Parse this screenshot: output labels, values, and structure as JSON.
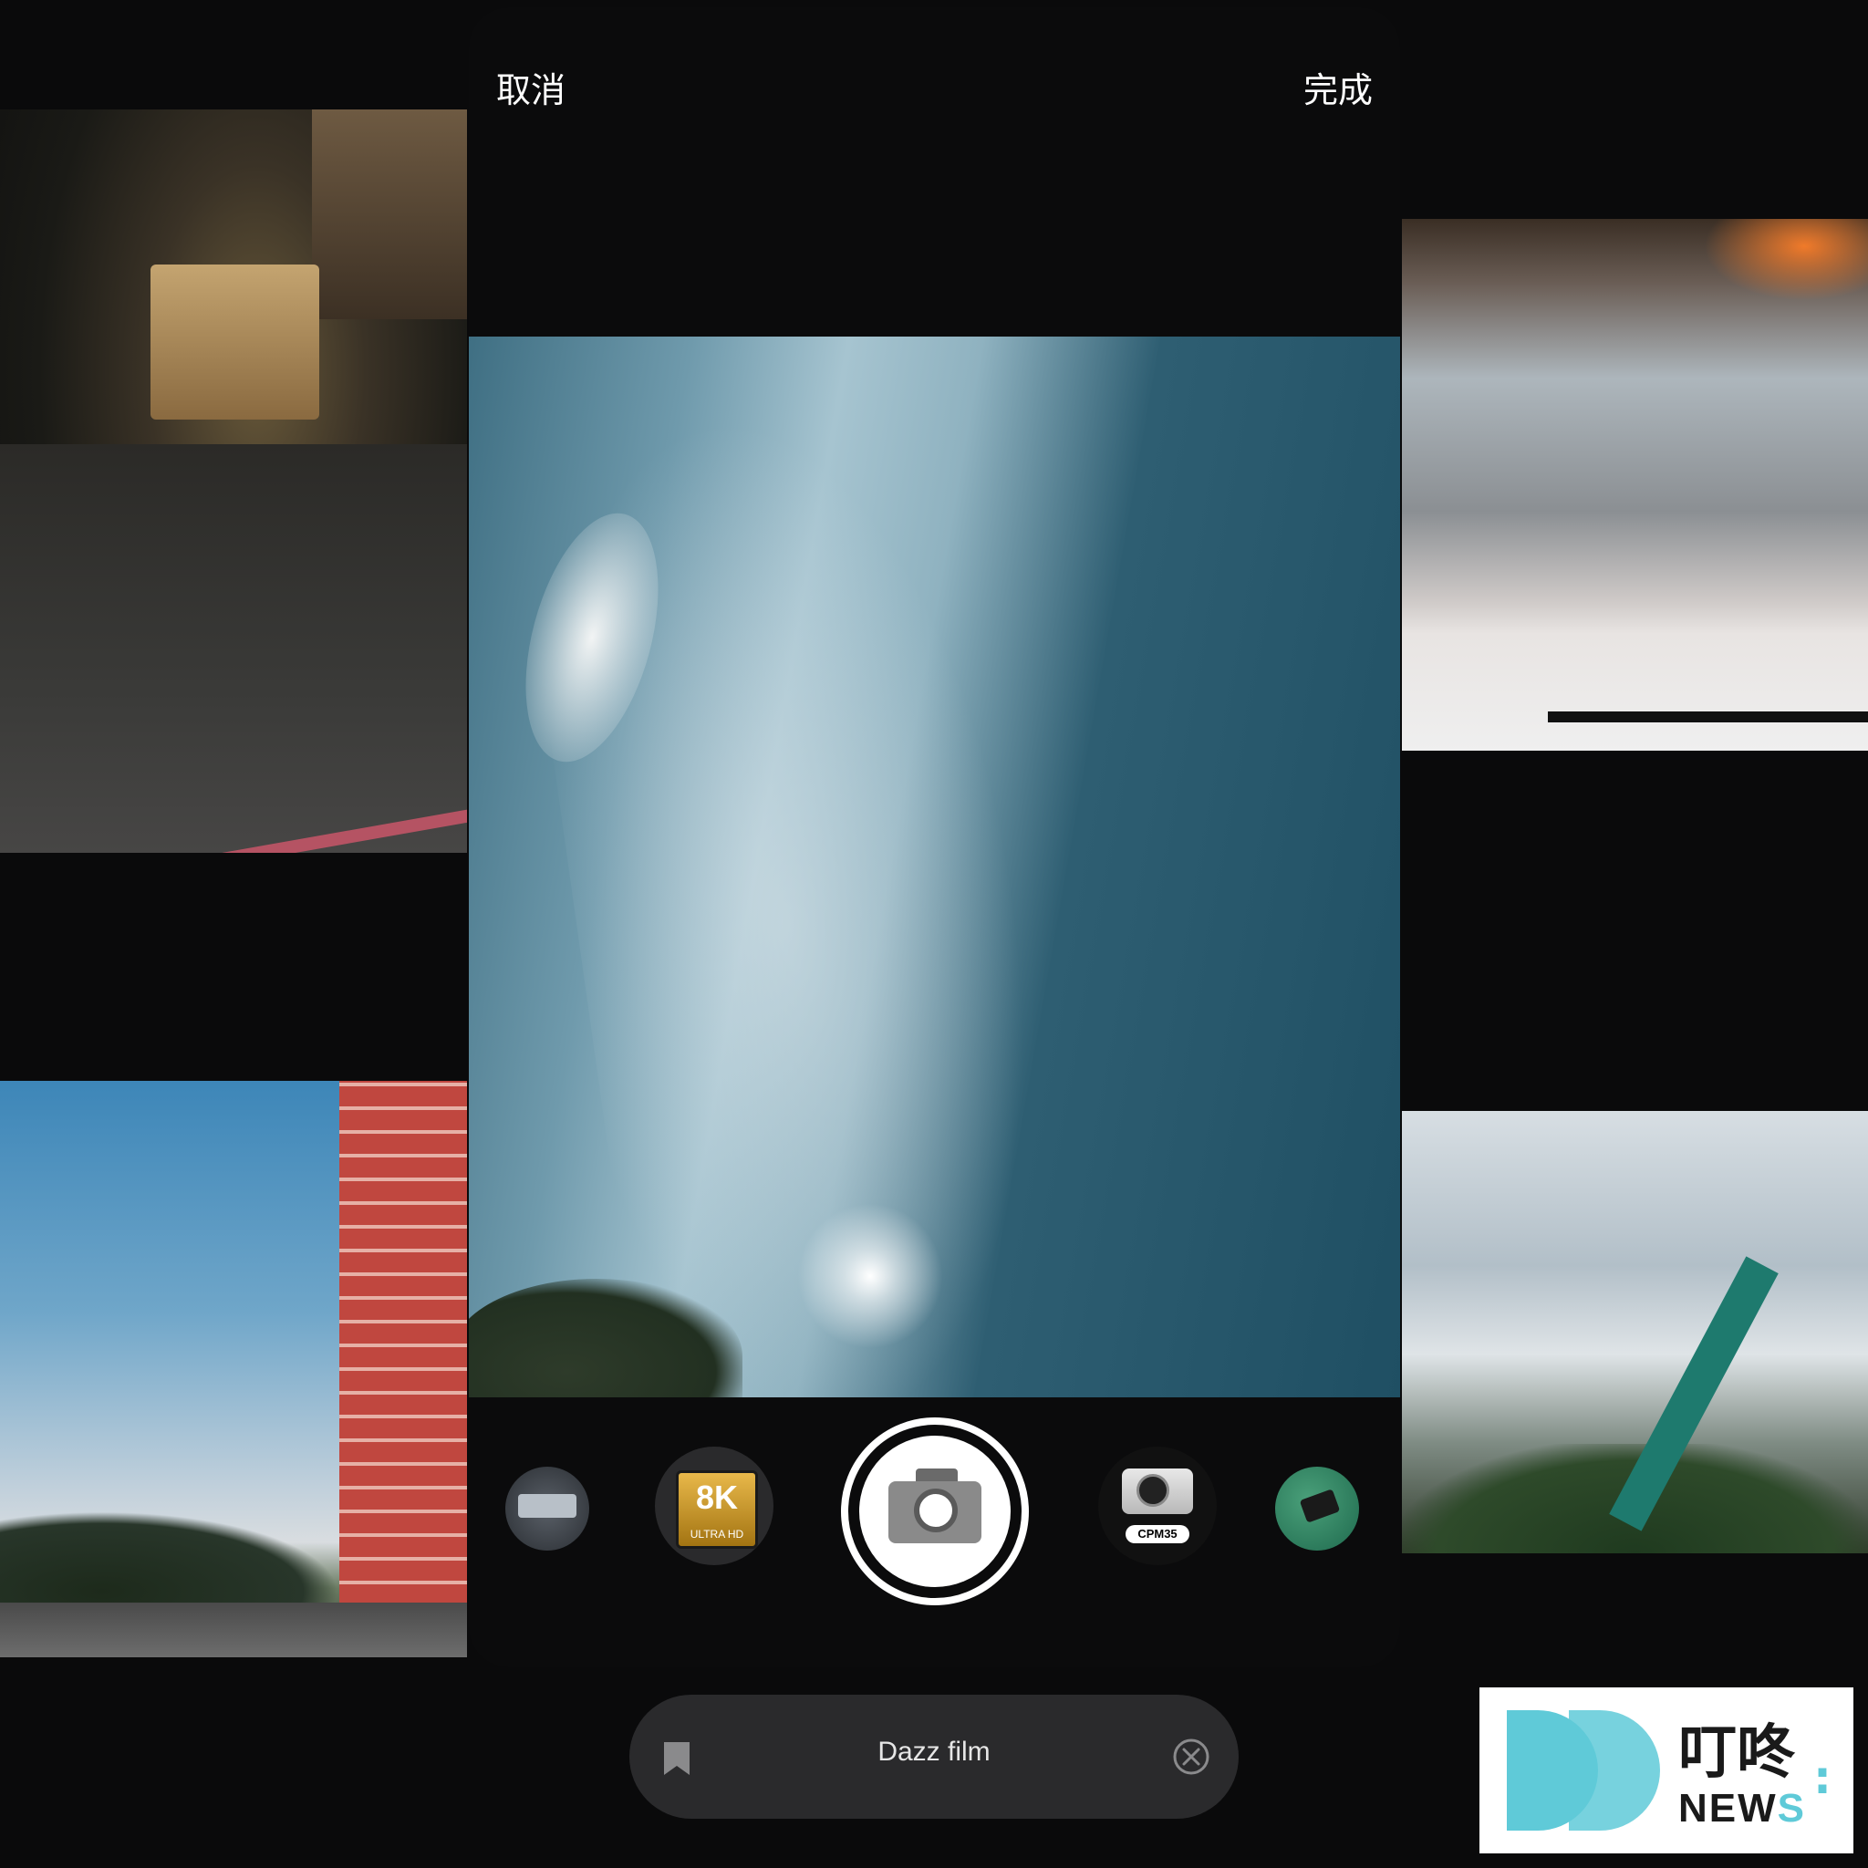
{
  "topbar": {
    "cancel_label": "取消",
    "done_label": "完成"
  },
  "viewfinder": {
    "description_icon": "film-preview"
  },
  "cameras": [
    {
      "icon": "retro-window-camera-icon"
    },
    {
      "icon": "ultra-hd-8k-camera-icon",
      "badge_main": "8K",
      "badge_sub": "ULTRA HD"
    },
    {
      "icon": "film-slr-camera-icon",
      "selected": true
    },
    {
      "icon": "cpm35-camera-icon",
      "label": "CPM35"
    },
    {
      "icon": "handheld-device-camera-icon"
    }
  ],
  "filterbar": {
    "name": "Dazz film",
    "bookmark_icon": "bookmark-icon",
    "clear_icon": "close-circle-icon"
  },
  "watermark": {
    "brand_cn": "叮咚",
    "brand_en_main": "NEW",
    "brand_en_tail": "S",
    "colon": ":",
    "accent": "#5fcad8"
  }
}
